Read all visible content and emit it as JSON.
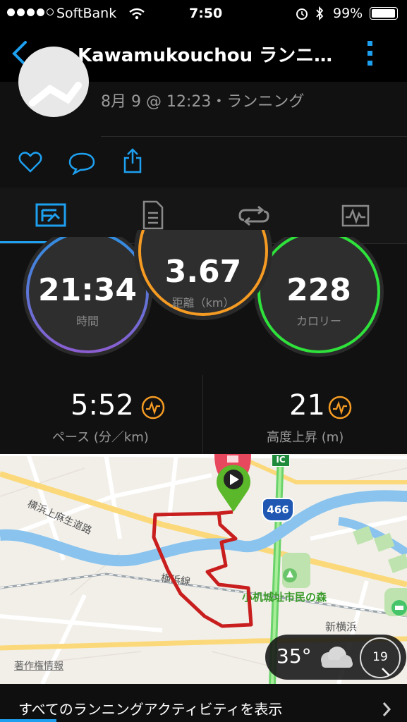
{
  "status_bar": {
    "carrier": "SoftBank",
    "time": "7:50",
    "battery": "99%"
  },
  "header": {
    "back_icon": "chevron-left-icon",
    "title": "Kawamukouchou ランニ…",
    "menu_icon": "kebab-menu-icon"
  },
  "activity": {
    "meta": "8月 9 @ 12:23・ランニング"
  },
  "actions": {
    "like_icon": "heart-icon",
    "comment_icon": "comment-icon",
    "share_icon": "share-icon"
  },
  "tabs": [
    {
      "icon": "stats-tab-icon",
      "active": true
    },
    {
      "icon": "details-tab-icon",
      "active": false
    },
    {
      "icon": "laps-tab-icon",
      "active": false
    },
    {
      "icon": "charts-tab-icon",
      "active": false
    }
  ],
  "summary": {
    "time": {
      "value": "21:34",
      "label": "時間"
    },
    "distance": {
      "value": "3.67",
      "label": "距離（km）"
    },
    "calories": {
      "value": "228",
      "label": "カロリー"
    }
  },
  "stats": {
    "pace": {
      "value": "5:52",
      "label": "ペース (分／km)"
    },
    "elevation": {
      "value": "21",
      "label": "高度上昇 (m)"
    }
  },
  "map": {
    "labels": {
      "road1": "横浜上麻生道路",
      "rail": "横浜線",
      "park": "小机城址市民の森",
      "station": "新横浜",
      "route_shield": "466",
      "ic": "IC",
      "copyright": "著作権情報"
    },
    "weather": {
      "temperature": "35°",
      "icon": "cloudy-icon",
      "wind_speed": "19"
    }
  },
  "footer": {
    "link": "すべてのランニングアクティビティを表示"
  },
  "colors": {
    "accent": "#1ea0f0",
    "time_ring": "#7a6fd8",
    "distance_ring": "#f59b23",
    "calorie_ring": "#2ee23b",
    "route": "#c81e1e",
    "start_pin": "#5ab82a",
    "insight": "#f59b23"
  }
}
